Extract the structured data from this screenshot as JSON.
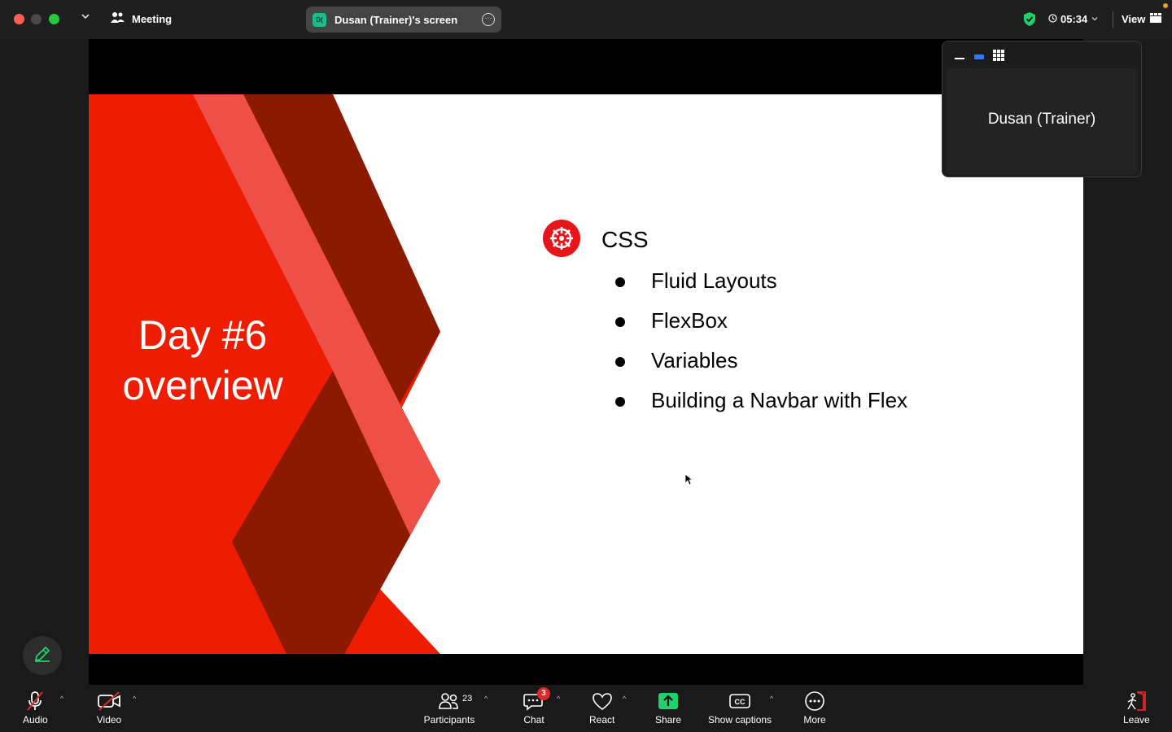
{
  "window": {
    "meeting_label": "Meeting",
    "screen_share_label": "Dusan (Trainer)'s screen",
    "screen_share_avatar": "D(",
    "timer": "05:34",
    "view_label": "View"
  },
  "slide": {
    "title_line1": "Day #6",
    "title_line2": "overview",
    "heading": "CSS",
    "bullets": [
      "Fluid Layouts",
      "FlexBox",
      "Variables",
      "Building a Navbar with Flex"
    ]
  },
  "thumbnail": {
    "participant_name": "Dusan (Trainer)"
  },
  "toolbar": {
    "audio_label": "Audio",
    "video_label": "Video",
    "participants_label": "Participants",
    "participants_count": "23",
    "chat_label": "Chat",
    "chat_badge": "3",
    "react_label": "React",
    "share_label": "Share",
    "captions_label": "Show captions",
    "more_label": "More",
    "leave_label": "Leave"
  },
  "colors": {
    "accent_green": "#1fd06b",
    "slide_red": "#ee1c00",
    "slide_dark_red": "#8b1a00",
    "slide_stripe": "#ee5048",
    "badge_red": "#e02828"
  }
}
